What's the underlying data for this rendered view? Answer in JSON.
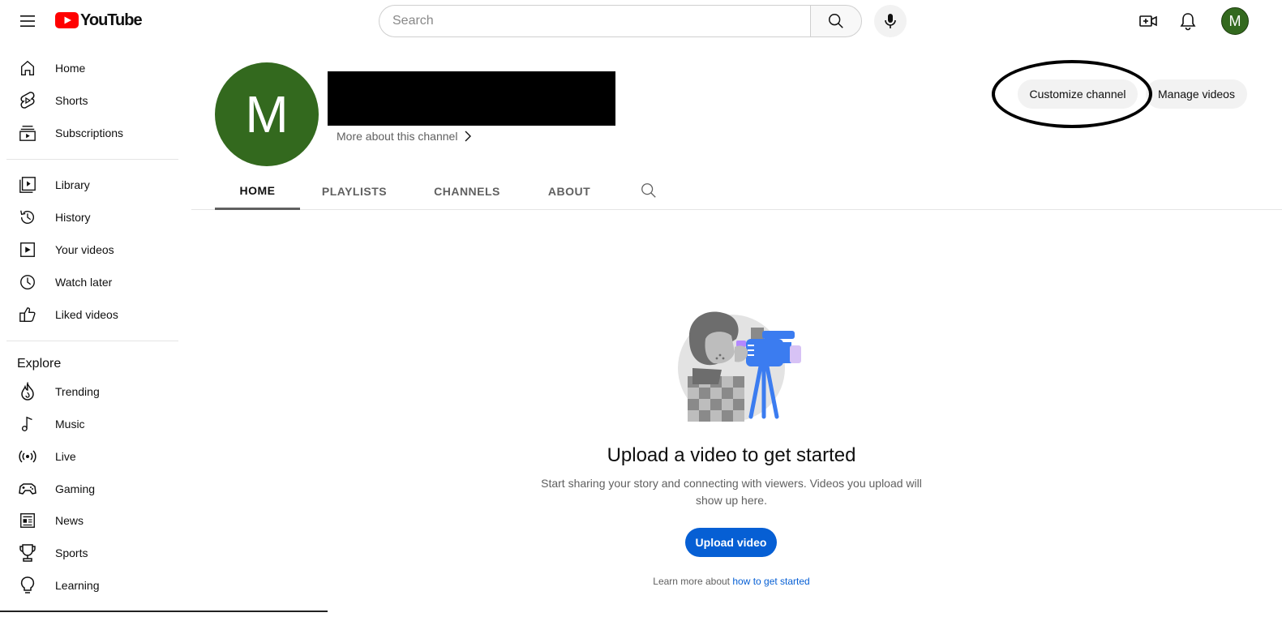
{
  "header": {
    "logo_text": "YouTube",
    "search_placeholder": "Search",
    "avatar_letter": "M"
  },
  "sidebar": {
    "main": [
      {
        "label": "Home",
        "icon": "home-icon"
      },
      {
        "label": "Shorts",
        "icon": "shorts-icon"
      },
      {
        "label": "Subscriptions",
        "icon": "subscriptions-icon"
      }
    ],
    "library": [
      {
        "label": "Library",
        "icon": "library-icon"
      },
      {
        "label": "History",
        "icon": "history-icon"
      },
      {
        "label": "Your videos",
        "icon": "your-videos-icon"
      },
      {
        "label": "Watch later",
        "icon": "watch-later-icon"
      },
      {
        "label": "Liked videos",
        "icon": "liked-videos-icon"
      }
    ],
    "explore_heading": "Explore",
    "explore": [
      {
        "label": "Trending",
        "icon": "trending-icon"
      },
      {
        "label": "Music",
        "icon": "music-icon"
      },
      {
        "label": "Live",
        "icon": "live-icon"
      },
      {
        "label": "Gaming",
        "icon": "gaming-icon"
      },
      {
        "label": "News",
        "icon": "news-icon"
      },
      {
        "label": "Sports",
        "icon": "sports-icon"
      },
      {
        "label": "Learning",
        "icon": "learning-icon"
      }
    ]
  },
  "channel": {
    "avatar_letter": "M",
    "more_about": "More about this channel",
    "customize_label": "Customize channel",
    "manage_label": "Manage videos"
  },
  "tabs": [
    {
      "label": "HOME",
      "active": true
    },
    {
      "label": "PLAYLISTS",
      "active": false
    },
    {
      "label": "CHANNELS",
      "active": false
    },
    {
      "label": "ABOUT",
      "active": false
    }
  ],
  "empty_state": {
    "title": "Upload a video to get started",
    "subtitle": "Start sharing your story and connecting with viewers. Videos you upload will show up here.",
    "upload_label": "Upload video",
    "learn_prefix": "Learn more about",
    "learn_link": "how to get started"
  },
  "colors": {
    "brand_red": "#ff0000",
    "avatar_green": "#33691e",
    "link_blue": "#065fd4"
  }
}
